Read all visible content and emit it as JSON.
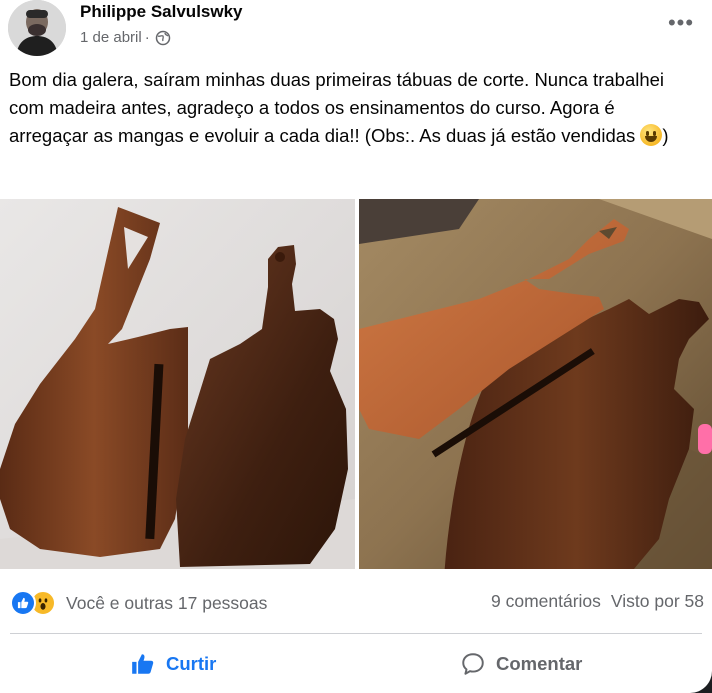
{
  "post": {
    "author": "Philippe Salvulswky",
    "date": "1 de abril",
    "separator": "·",
    "privacy_icon": "globe-icon",
    "more_icon": "more-options-icon",
    "more_label": "•••",
    "text_main": "Bom dia galera, saíram minhas duas primeiras tábuas de corte. Nunca trabalhei com madeira antes, agradeço a todos os ensinamentos do curso. Agora é arregaçar as mangas e evoluir a cada dia!! (Obs:. As duas já estão vendidas ",
    "text_end": ")",
    "emoji": "smiling-face-emoji"
  },
  "photos": [
    {
      "name": "photo-cutting-boards-white-background",
      "description_icon": "image"
    },
    {
      "name": "photo-cutting-boards-wood-table",
      "description_icon": "image"
    }
  ],
  "reactions": {
    "icons": [
      "like-reaction-icon",
      "wow-reaction-icon"
    ],
    "text": "Você e outras 17 pessoas"
  },
  "stats": {
    "comments": "9 comentários",
    "views": "Visto por 58"
  },
  "actions": {
    "like_label": "Curtir",
    "comment_label": "Comentar"
  },
  "colors": {
    "accent": "#1877f2",
    "secondary_text": "#65676b",
    "divider": "#ced0d4"
  }
}
